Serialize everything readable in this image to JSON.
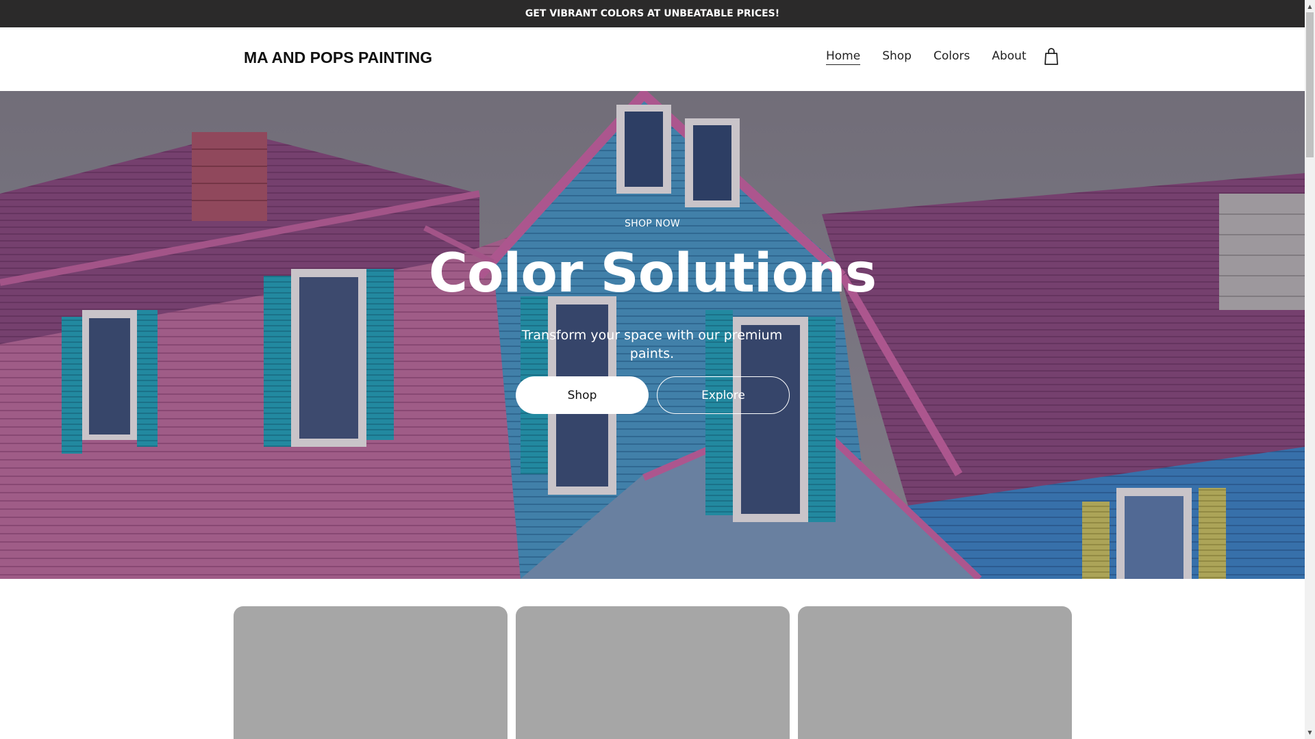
{
  "announcement": {
    "text": "GET VIBRANT COLORS AT UNBEATABLE PRICES!"
  },
  "header": {
    "brand": "MA AND POPS PAINTING",
    "nav": [
      {
        "label": "Home",
        "active": true
      },
      {
        "label": "Shop",
        "active": false
      },
      {
        "label": "Colors",
        "active": false
      },
      {
        "label": "About",
        "active": false
      }
    ],
    "cart_icon": "shopping-bag-icon"
  },
  "hero": {
    "eyebrow": "SHOP NOW",
    "title": "Color Solutions",
    "subtitle": "Transform your space with our premium paints.",
    "primary_button": "Shop",
    "secondary_button": "Explore",
    "image": "pink-and-blue-painted-house"
  },
  "cards": [
    {
      "label": ""
    },
    {
      "label": ""
    },
    {
      "label": ""
    }
  ],
  "colors": {
    "announcement_bg": "#2b2a2a",
    "card_placeholder": "#a6a6a6",
    "house_pink": "#c96fa6",
    "house_blue": "#3f8fd0",
    "shutter_teal": "#2bb7c6"
  }
}
